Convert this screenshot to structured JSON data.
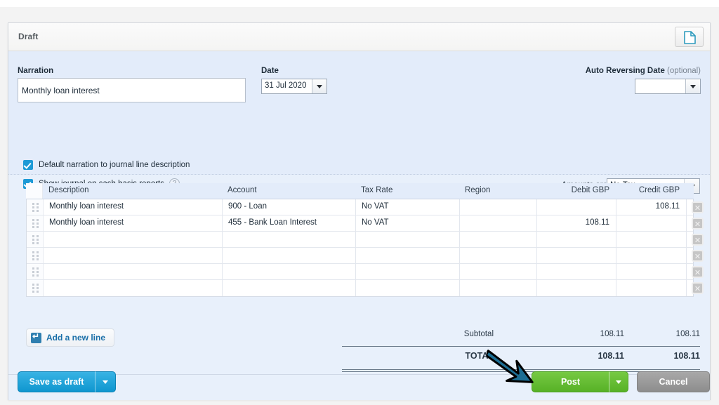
{
  "panel": {
    "status_title": "Draft",
    "doc_icon": "file-page-icon"
  },
  "form": {
    "narration_label": "Narration",
    "narration_value": "Monthly loan interest",
    "narration_placeholder": "",
    "date_label": "Date",
    "date_value": "31 Jul 2020",
    "auto_reversing_label": "Auto Reversing Date",
    "auto_reversing_optional": "(optional)",
    "auto_reversing_value": "",
    "checkbox_default_narration": "Default narration to journal line description",
    "checkbox_show_journal": "Show journal on cash basis reports",
    "help_glyph": "?"
  },
  "amounts": {
    "label": "Amounts are",
    "selected": "No Tax"
  },
  "grid": {
    "columns": [
      "Description",
      "Account",
      "Tax Rate",
      "Region",
      "Debit GBP",
      "Credit GBP"
    ],
    "rows": [
      {
        "description": "Monthly loan interest",
        "account": "900 - Loan",
        "tax_rate": "No VAT",
        "region": "",
        "debit": "",
        "credit": "108.11"
      },
      {
        "description": "Monthly loan interest",
        "account": "455 - Bank Loan Interest",
        "tax_rate": "No VAT",
        "region": "",
        "debit": "108.11",
        "credit": ""
      },
      {
        "description": "",
        "account": "",
        "tax_rate": "",
        "region": "",
        "debit": "",
        "credit": ""
      },
      {
        "description": "",
        "account": "",
        "tax_rate": "",
        "region": "",
        "debit": "",
        "credit": ""
      },
      {
        "description": "",
        "account": "",
        "tax_rate": "",
        "region": "",
        "debit": "",
        "credit": ""
      },
      {
        "description": "",
        "account": "",
        "tax_rate": "",
        "region": "",
        "debit": "",
        "credit": ""
      }
    ],
    "delete_glyph": "✕",
    "add_line_label": "Add a new line"
  },
  "totals": {
    "subtotal_label": "Subtotal",
    "subtotal_debit": "108.11",
    "subtotal_credit": "108.11",
    "total_label": "TOTAL",
    "total_debit": "108.11",
    "total_credit": "108.11"
  },
  "footer": {
    "save_draft_label": "Save as draft",
    "post_label": "Post",
    "cancel_label": "Cancel"
  },
  "colors": {
    "panel_bg": "#e3ecfa",
    "primary_blue": "#1c9ad6",
    "post_green": "#63bd33",
    "cancel_grey": "#9a9a9a",
    "arrow_teal": "#1c6d93"
  }
}
